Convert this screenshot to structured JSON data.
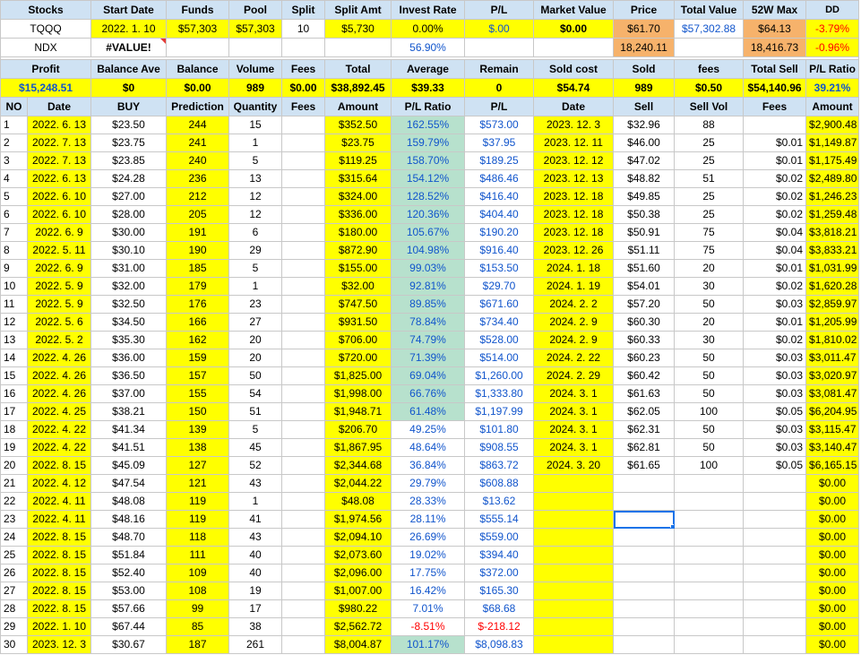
{
  "header1": {
    "labels": [
      "Stocks",
      "Start Date",
      "Funds",
      "Pool",
      "Split",
      "Split Amt",
      "Invest Rate",
      "P/L",
      "Market Value",
      "Price",
      "Total Value",
      "52W Max",
      "DD"
    ]
  },
  "tqqq": {
    "symbol": "TQQQ",
    "start_date": "2022. 1. 10",
    "funds": "$57,303",
    "pool": "$57,303",
    "split": "10",
    "split_amt": "$5,730",
    "invest_rate": "0.00%",
    "pl": "$.00",
    "market_value": "$0.00",
    "price": "$61.70",
    "total_value": "$57,302.88",
    "max52": "$64.13",
    "dd": "-3.79%"
  },
  "ndx": {
    "symbol": "NDX",
    "error": "#VALUE!",
    "invest_rate": "56.90%",
    "price": "18,240.11",
    "max52": "18,416.73",
    "dd": "-0.96%"
  },
  "header2": {
    "labels": [
      "Profit",
      "Balance Ave",
      "Balance",
      "Volume",
      "Fees",
      "Total",
      "Average",
      "Remain",
      "Sold cost",
      "Sold",
      "fees",
      "Total Sell",
      "P/L Ratio"
    ]
  },
  "summary": {
    "profit": "$15,248.51",
    "balance_ave": "$0",
    "balance": "$0.00",
    "volume": "989",
    "fees": "$0.00",
    "total": "$38,892.45",
    "average": "$39.33",
    "remain": "0",
    "sold_cost": "$54.74",
    "sold": "989",
    "fees2": "$0.50",
    "total_sell": "$54,140.96",
    "pl_ratio": "39.21%"
  },
  "header3": {
    "labels": [
      "NO",
      "Date",
      "BUY",
      "Prediction",
      "Quantity",
      "Fees",
      "Amount",
      "P/L Ratio",
      "P/L",
      "Date",
      "Sell",
      "Sell Vol",
      "Fees",
      "Amount"
    ]
  },
  "colors": {
    "header": "#cfe2f3",
    "yellow": "#ffff00",
    "orange": "#f6b26b",
    "green": "#b7e1cd",
    "blue": "#1155cc",
    "red": "#ff0000",
    "selection": "#1a73e8"
  },
  "rows": [
    {
      "no": "1",
      "date": "2022. 6. 13",
      "buy": "$23.50",
      "pred": "244",
      "qty": "15",
      "fees": "",
      "amount": "$352.50",
      "ratio": "162.55%",
      "pl": "$573.00",
      "sdate": "2023. 12. 3",
      "sell": "$32.96",
      "svol": "88",
      "sfees": "",
      "samount": "$2,900.48"
    },
    {
      "no": "2",
      "date": "2022. 7. 13",
      "buy": "$23.75",
      "pred": "241",
      "qty": "1",
      "fees": "",
      "amount": "$23.75",
      "ratio": "159.79%",
      "pl": "$37.95",
      "sdate": "2023. 12. 11",
      "sell": "$46.00",
      "svol": "25",
      "sfees": "$0.01",
      "samount": "$1,149.87"
    },
    {
      "no": "3",
      "date": "2022. 7. 13",
      "buy": "$23.85",
      "pred": "240",
      "qty": "5",
      "fees": "",
      "amount": "$119.25",
      "ratio": "158.70%",
      "pl": "$189.25",
      "sdate": "2023. 12. 12",
      "sell": "$47.02",
      "svol": "25",
      "sfees": "$0.01",
      "samount": "$1,175.49"
    },
    {
      "no": "4",
      "date": "2022. 6. 13",
      "buy": "$24.28",
      "pred": "236",
      "qty": "13",
      "fees": "",
      "amount": "$315.64",
      "ratio": "154.12%",
      "pl": "$486.46",
      "sdate": "2023. 12. 13",
      "sell": "$48.82",
      "svol": "51",
      "sfees": "$0.02",
      "samount": "$2,489.80"
    },
    {
      "no": "5",
      "date": "2022. 6. 10",
      "buy": "$27.00",
      "pred": "212",
      "qty": "12",
      "fees": "",
      "amount": "$324.00",
      "ratio": "128.52%",
      "pl": "$416.40",
      "sdate": "2023. 12. 18",
      "sell": "$49.85",
      "svol": "25",
      "sfees": "$0.02",
      "samount": "$1,246.23"
    },
    {
      "no": "6",
      "date": "2022. 6. 10",
      "buy": "$28.00",
      "pred": "205",
      "qty": "12",
      "fees": "",
      "amount": "$336.00",
      "ratio": "120.36%",
      "pl": "$404.40",
      "sdate": "2023. 12. 18",
      "sell": "$50.38",
      "svol": "25",
      "sfees": "$0.02",
      "samount": "$1,259.48"
    },
    {
      "no": "7",
      "date": "2022. 6. 9",
      "buy": "$30.00",
      "pred": "191",
      "qty": "6",
      "fees": "",
      "amount": "$180.00",
      "ratio": "105.67%",
      "pl": "$190.20",
      "sdate": "2023. 12. 18",
      "sell": "$50.91",
      "svol": "75",
      "sfees": "$0.04",
      "samount": "$3,818.21"
    },
    {
      "no": "8",
      "date": "2022. 5. 11",
      "buy": "$30.10",
      "pred": "190",
      "qty": "29",
      "fees": "",
      "amount": "$872.90",
      "ratio": "104.98%",
      "pl": "$916.40",
      "sdate": "2023. 12. 26",
      "sell": "$51.11",
      "svol": "75",
      "sfees": "$0.04",
      "samount": "$3,833.21"
    },
    {
      "no": "9",
      "date": "2022. 6. 9",
      "buy": "$31.00",
      "pred": "185",
      "qty": "5",
      "fees": "",
      "amount": "$155.00",
      "ratio": "99.03%",
      "pl": "$153.50",
      "sdate": "2024. 1. 18",
      "sell": "$51.60",
      "svol": "20",
      "sfees": "$0.01",
      "samount": "$1,031.99"
    },
    {
      "no": "10",
      "date": "2022. 5. 9",
      "buy": "$32.00",
      "pred": "179",
      "qty": "1",
      "fees": "",
      "amount": "$32.00",
      "ratio": "92.81%",
      "pl": "$29.70",
      "sdate": "2024. 1. 19",
      "sell": "$54.01",
      "svol": "30",
      "sfees": "$0.02",
      "samount": "$1,620.28"
    },
    {
      "no": "11",
      "date": "2022. 5. 9",
      "buy": "$32.50",
      "pred": "176",
      "qty": "23",
      "fees": "",
      "amount": "$747.50",
      "ratio": "89.85%",
      "pl": "$671.60",
      "sdate": "2024. 2. 2",
      "sell": "$57.20",
      "svol": "50",
      "sfees": "$0.03",
      "samount": "$2,859.97"
    },
    {
      "no": "12",
      "date": "2022. 5. 6",
      "buy": "$34.50",
      "pred": "166",
      "qty": "27",
      "fees": "",
      "amount": "$931.50",
      "ratio": "78.84%",
      "pl": "$734.40",
      "sdate": "2024. 2. 9",
      "sell": "$60.30",
      "svol": "20",
      "sfees": "$0.01",
      "samount": "$1,205.99"
    },
    {
      "no": "13",
      "date": "2022. 5. 2",
      "buy": "$35.30",
      "pred": "162",
      "qty": "20",
      "fees": "",
      "amount": "$706.00",
      "ratio": "74.79%",
      "pl": "$528.00",
      "sdate": "2024. 2. 9",
      "sell": "$60.33",
      "svol": "30",
      "sfees": "$0.02",
      "samount": "$1,810.02"
    },
    {
      "no": "14",
      "date": "2022. 4. 26",
      "buy": "$36.00",
      "pred": "159",
      "qty": "20",
      "fees": "",
      "amount": "$720.00",
      "ratio": "71.39%",
      "pl": "$514.00",
      "sdate": "2024. 2. 22",
      "sell": "$60.23",
      "svol": "50",
      "sfees": "$0.03",
      "samount": "$3,011.47"
    },
    {
      "no": "15",
      "date": "2022. 4. 26",
      "buy": "$36.50",
      "pred": "157",
      "qty": "50",
      "fees": "",
      "amount": "$1,825.00",
      "ratio": "69.04%",
      "pl": "$1,260.00",
      "sdate": "2024. 2. 29",
      "sell": "$60.42",
      "svol": "50",
      "sfees": "$0.03",
      "samount": "$3,020.97"
    },
    {
      "no": "16",
      "date": "2022. 4. 26",
      "buy": "$37.00",
      "pred": "155",
      "qty": "54",
      "fees": "",
      "amount": "$1,998.00",
      "ratio": "66.76%",
      "pl": "$1,333.80",
      "sdate": "2024. 3. 1",
      "sell": "$61.63",
      "svol": "50",
      "sfees": "$0.03",
      "samount": "$3,081.47"
    },
    {
      "no": "17",
      "date": "2022. 4. 25",
      "buy": "$38.21",
      "pred": "150",
      "qty": "51",
      "fees": "",
      "amount": "$1,948.71",
      "ratio": "61.48%",
      "pl": "$1,197.99",
      "sdate": "2024. 3. 1",
      "sell": "$62.05",
      "svol": "100",
      "sfees": "$0.05",
      "samount": "$6,204.95"
    },
    {
      "no": "18",
      "date": "2022. 4. 22",
      "buy": "$41.34",
      "pred": "139",
      "qty": "5",
      "fees": "",
      "amount": "$206.70",
      "ratio": "49.25%",
      "pl": "$101.80",
      "sdate": "2024. 3. 1",
      "sell": "$62.31",
      "svol": "50",
      "sfees": "$0.03",
      "samount": "$3,115.47"
    },
    {
      "no": "19",
      "date": "2022. 4. 22",
      "buy": "$41.51",
      "pred": "138",
      "qty": "45",
      "fees": "",
      "amount": "$1,867.95",
      "ratio": "48.64%",
      "pl": "$908.55",
      "sdate": "2024. 3. 1",
      "sell": "$62.81",
      "svol": "50",
      "sfees": "$0.03",
      "samount": "$3,140.47"
    },
    {
      "no": "20",
      "date": "2022. 8. 15",
      "buy": "$45.09",
      "pred": "127",
      "qty": "52",
      "fees": "",
      "amount": "$2,344.68",
      "ratio": "36.84%",
      "pl": "$863.72",
      "sdate": "2024. 3. 20",
      "sell": "$61.65",
      "svol": "100",
      "sfees": "$0.05",
      "samount": "$6,165.15"
    },
    {
      "no": "21",
      "date": "2022. 4. 12",
      "buy": "$47.54",
      "pred": "121",
      "qty": "43",
      "fees": "",
      "amount": "$2,044.22",
      "ratio": "29.79%",
      "pl": "$608.88",
      "sdate": "",
      "sell": "",
      "svol": "",
      "sfees": "",
      "samount": "$0.00"
    },
    {
      "no": "22",
      "date": "2022. 4. 11",
      "buy": "$48.08",
      "pred": "119",
      "qty": "1",
      "fees": "",
      "amount": "$48.08",
      "ratio": "28.33%",
      "pl": "$13.62",
      "sdate": "",
      "sell": "",
      "svol": "",
      "sfees": "",
      "samount": "$0.00"
    },
    {
      "no": "23",
      "date": "2022. 4. 11",
      "buy": "$48.16",
      "pred": "119",
      "qty": "41",
      "fees": "",
      "amount": "$1,974.56",
      "ratio": "28.11%",
      "pl": "$555.14",
      "sdate": "",
      "sell": "",
      "svol": "",
      "sfees": "",
      "samount": "$0.00"
    },
    {
      "no": "24",
      "date": "2022. 8. 15",
      "buy": "$48.70",
      "pred": "118",
      "qty": "43",
      "fees": "",
      "amount": "$2,094.10",
      "ratio": "26.69%",
      "pl": "$559.00",
      "sdate": "",
      "sell": "",
      "svol": "",
      "sfees": "",
      "samount": "$0.00"
    },
    {
      "no": "25",
      "date": "2022. 8. 15",
      "buy": "$51.84",
      "pred": "111",
      "qty": "40",
      "fees": "",
      "amount": "$2,073.60",
      "ratio": "19.02%",
      "pl": "$394.40",
      "sdate": "",
      "sell": "",
      "svol": "",
      "sfees": "",
      "samount": "$0.00"
    },
    {
      "no": "26",
      "date": "2022. 8. 15",
      "buy": "$52.40",
      "pred": "109",
      "qty": "40",
      "fees": "",
      "amount": "$2,096.00",
      "ratio": "17.75%",
      "pl": "$372.00",
      "sdate": "",
      "sell": "",
      "svol": "",
      "sfees": "",
      "samount": "$0.00"
    },
    {
      "no": "27",
      "date": "2022. 8. 15",
      "buy": "$53.00",
      "pred": "108",
      "qty": "19",
      "fees": "",
      "amount": "$1,007.00",
      "ratio": "16.42%",
      "pl": "$165.30",
      "sdate": "",
      "sell": "",
      "svol": "",
      "sfees": "",
      "samount": "$0.00"
    },
    {
      "no": "28",
      "date": "2022. 8. 15",
      "buy": "$57.66",
      "pred": "99",
      "qty": "17",
      "fees": "",
      "amount": "$980.22",
      "ratio": "7.01%",
      "pl": "$68.68",
      "sdate": "",
      "sell": "",
      "svol": "",
      "sfees": "",
      "samount": "$0.00"
    },
    {
      "no": "29",
      "date": "2022. 1. 10",
      "buy": "$67.44",
      "pred": "85",
      "qty": "38",
      "fees": "",
      "amount": "$2,562.72",
      "ratio": "-8.51%",
      "pl": "$-218.12",
      "sdate": "",
      "sell": "",
      "svol": "",
      "sfees": "",
      "samount": "$0.00"
    },
    {
      "no": "30",
      "date": "2023. 12. 3",
      "buy": "$30.67",
      "pred": "187",
      "qty": "261",
      "fees": "",
      "amount": "$8,004.87",
      "ratio": "101.17%",
      "pl": "$8,098.83",
      "sdate": "",
      "sell": "",
      "svol": "",
      "sfees": "",
      "samount": "$0.00"
    }
  ]
}
